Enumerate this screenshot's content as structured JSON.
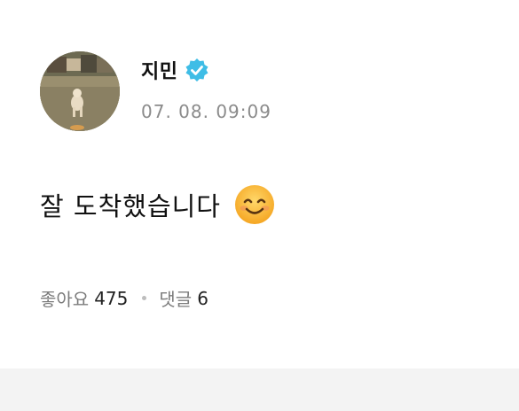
{
  "post": {
    "author": "지민",
    "verified_icon": "verified-badge-icon",
    "timestamp": "07. 08. 09:09",
    "text": "잘 도착했습니다",
    "emoji_icon": "smiling-face-icon",
    "likes_label": "좋아요",
    "likes_count": "475",
    "comments_label": "댓글",
    "comments_count": "6"
  },
  "colors": {
    "verified": "#3fbde6",
    "text": "#111111",
    "muted": "#8b8b8b",
    "footer_band": "#f3f3f3"
  }
}
